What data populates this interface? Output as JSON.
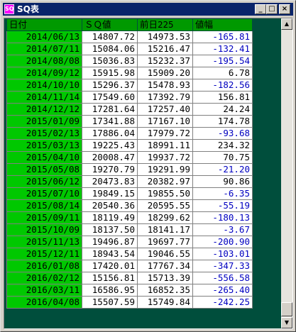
{
  "window": {
    "title": "SQ表",
    "icon": "app-icon",
    "minimize_label": "_",
    "maximize_label": "□",
    "close_label": "×"
  },
  "table": {
    "headers": [
      "日付",
      "ＳＱ値",
      "前日225",
      "値幅"
    ],
    "rows": [
      {
        "date": "2014/06/13",
        "sq": "14807.72",
        "prev": "14973.53",
        "diff": "-165.81"
      },
      {
        "date": "2014/07/11",
        "sq": "15084.06",
        "prev": "15216.47",
        "diff": "-132.41"
      },
      {
        "date": "2014/08/08",
        "sq": "15036.83",
        "prev": "15232.37",
        "diff": "-195.54"
      },
      {
        "date": "2014/09/12",
        "sq": "15915.98",
        "prev": "15909.20",
        "diff": "6.78"
      },
      {
        "date": "2014/10/10",
        "sq": "15296.37",
        "prev": "15478.93",
        "diff": "-182.56"
      },
      {
        "date": "2014/11/14",
        "sq": "17549.60",
        "prev": "17392.79",
        "diff": "156.81"
      },
      {
        "date": "2014/12/12",
        "sq": "17281.64",
        "prev": "17257.40",
        "diff": "24.24"
      },
      {
        "date": "2015/01/09",
        "sq": "17341.88",
        "prev": "17167.10",
        "diff": "174.78"
      },
      {
        "date": "2015/02/13",
        "sq": "17886.04",
        "prev": "17979.72",
        "diff": "-93.68"
      },
      {
        "date": "2015/03/13",
        "sq": "19225.43",
        "prev": "18991.11",
        "diff": "234.32"
      },
      {
        "date": "2015/04/10",
        "sq": "20008.47",
        "prev": "19937.72",
        "diff": "70.75"
      },
      {
        "date": "2015/05/08",
        "sq": "19270.79",
        "prev": "19291.99",
        "diff": "-21.20"
      },
      {
        "date": "2015/06/12",
        "sq": "20473.83",
        "prev": "20382.97",
        "diff": "90.86"
      },
      {
        "date": "2015/07/10",
        "sq": "19849.15",
        "prev": "19855.50",
        "diff": "-6.35"
      },
      {
        "date": "2015/08/14",
        "sq": "20540.36",
        "prev": "20595.55",
        "diff": "-55.19"
      },
      {
        "date": "2015/09/11",
        "sq": "18119.49",
        "prev": "18299.62",
        "diff": "-180.13"
      },
      {
        "date": "2015/10/09",
        "sq": "18137.50",
        "prev": "18141.17",
        "diff": "-3.67"
      },
      {
        "date": "2015/11/13",
        "sq": "19496.87",
        "prev": "19697.77",
        "diff": "-200.90"
      },
      {
        "date": "2015/12/11",
        "sq": "18943.54",
        "prev": "19046.55",
        "diff": "-103.01"
      },
      {
        "date": "2016/01/08",
        "sq": "17420.01",
        "prev": "17767.34",
        "diff": "-347.33"
      },
      {
        "date": "2016/02/12",
        "sq": "15156.81",
        "prev": "15713.39",
        "diff": "-556.58"
      },
      {
        "date": "2016/03/11",
        "sq": "16586.95",
        "prev": "16852.35",
        "diff": "-265.40"
      },
      {
        "date": "2016/04/08",
        "sq": "15507.59",
        "prev": "15749.84",
        "diff": "-242.25"
      }
    ]
  },
  "colors": {
    "date_cell": "#00c800",
    "header": "#009900",
    "background": "#004e3c",
    "negative": "#0000c0"
  }
}
